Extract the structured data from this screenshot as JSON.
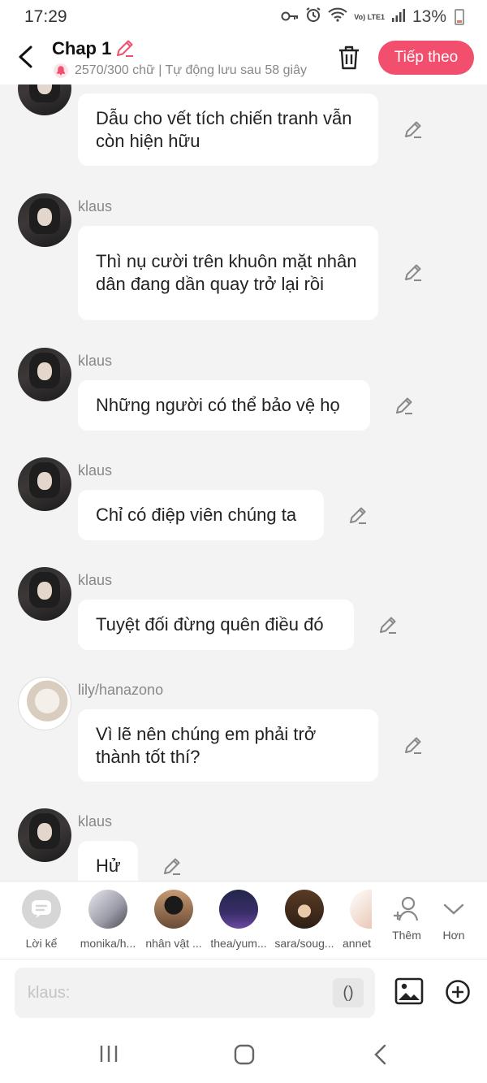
{
  "status": {
    "time": "17:29",
    "network_label": "Vo) LTE1",
    "battery": "13%"
  },
  "header": {
    "title": "Chap 1",
    "subtitle": "2570/300 chữ | Tự động lưu sau 58 giây",
    "next_label": "Tiếp theo"
  },
  "messages": [
    {
      "name": "",
      "text": "Dẫu cho vết tích chiến tranh vẫn còn hiện hữu",
      "avatar": "klaus"
    },
    {
      "name": "klaus",
      "text": "Thì nụ cười trên khuôn mặt nhân dân đang dần quay trở lại rồi",
      "avatar": "klaus"
    },
    {
      "name": "klaus",
      "text": "Những người có thể bảo vệ họ",
      "avatar": "klaus"
    },
    {
      "name": "klaus",
      "text": "Chỉ có điệp viên chúng ta",
      "avatar": "klaus"
    },
    {
      "name": "klaus",
      "text": "Tuyệt đối đừng quên điều đó",
      "avatar": "klaus"
    },
    {
      "name": "lily/hanazono",
      "text": "Vì lẽ nên chúng em phải trở thành tốt thí?",
      "avatar": "lily"
    },
    {
      "name": "klaus",
      "text": "Hử",
      "avatar": "klaus"
    }
  ],
  "characters": [
    {
      "label": "Lời kể"
    },
    {
      "label": "monika/h..."
    },
    {
      "label": "nhân vật ..."
    },
    {
      "label": "thea/yum..."
    },
    {
      "label": "sara/soug..."
    },
    {
      "label": "annet"
    }
  ],
  "actions": {
    "add_label": "Thêm",
    "more_label": "Hơn"
  },
  "composer": {
    "placeholder": "klaus:",
    "paren_label": "()"
  },
  "colors": {
    "accent": "#f24e6e",
    "background": "#f3f3f3",
    "bubble": "#ffffff"
  }
}
